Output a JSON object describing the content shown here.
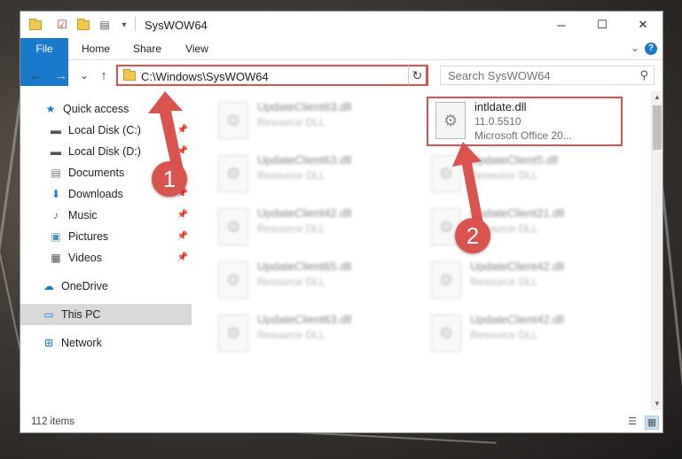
{
  "window": {
    "title": "SysWOW64",
    "controls": {
      "minimize": "─",
      "maximize": "☐",
      "close": "✕"
    }
  },
  "ribbon": {
    "tabs": [
      {
        "label": "File"
      },
      {
        "label": "Home"
      },
      {
        "label": "Share"
      },
      {
        "label": "View"
      }
    ],
    "help": "?"
  },
  "navigation": {
    "back": "←",
    "forward": "→",
    "recent": "⌄",
    "up": "↑",
    "address": "C:\\Windows\\SysWOW64",
    "refresh": "↻",
    "search_placeholder": "Search SysWOW64"
  },
  "sidebar": {
    "items": [
      {
        "label": "Quick access",
        "icon": "★"
      },
      {
        "label": "Local Disk (C:)",
        "icon": "▬"
      },
      {
        "label": "Local Disk (D:)",
        "icon": "▬"
      },
      {
        "label": "Documents",
        "icon": "▤"
      },
      {
        "label": "Downloads",
        "icon": "⬇"
      },
      {
        "label": "Music",
        "icon": "♪"
      },
      {
        "label": "Pictures",
        "icon": "▣"
      },
      {
        "label": "Videos",
        "icon": "▦"
      },
      {
        "label": "OneDrive",
        "icon": "☁"
      },
      {
        "label": "This PC",
        "icon": "▭"
      },
      {
        "label": "Network",
        "icon": "⊞"
      }
    ]
  },
  "files": [
    {
      "name": "UpdateClient63.dll",
      "type": "Resource DLL"
    },
    {
      "name": "intldate.dll",
      "version": "11.0.5510",
      "description": "Microsoft Office 20..."
    },
    {
      "name": "UpdateClient63.dll",
      "type": "Resource DLL"
    },
    {
      "name": "UpdateClient5.dll",
      "type": "Resource DLL"
    },
    {
      "name": "UpdateClient42.dll",
      "type": "Resource DLL"
    },
    {
      "name": "UpdateClient21.dll",
      "type": "Resource DLL"
    },
    {
      "name": "UpdateClient65.dll",
      "type": "Resource DLL"
    },
    {
      "name": "UpdateClient42.dll",
      "type": "Resource DLL"
    },
    {
      "name": "UpdateClient63.dll",
      "type": "Resource DLL"
    },
    {
      "name": "UpdateClient42.dll",
      "type": "Resource DLL"
    }
  ],
  "status": {
    "item_count": "112 items"
  },
  "annotations": {
    "step1": "1",
    "step2": "2"
  },
  "colors": {
    "accent": "#1979ca",
    "highlight": "#d9534f"
  }
}
